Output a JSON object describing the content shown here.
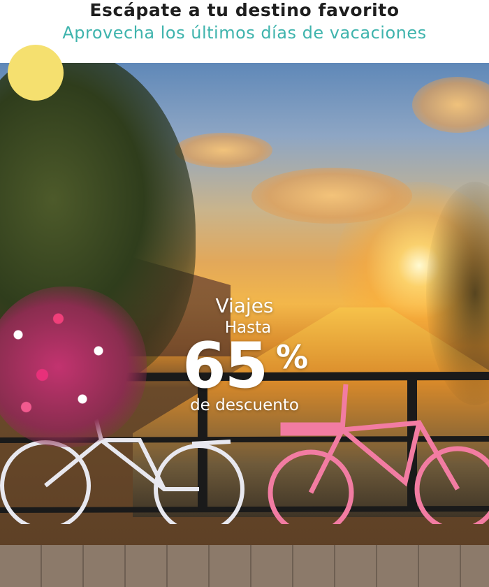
{
  "header": {
    "headline": "Escápate a tu destino favorito",
    "subline": "Aprovecha los últimos días de vacaciones"
  },
  "hero": {
    "image_description_icon": "amsterdam-canal-sunset-photo",
    "promo": {
      "title": "Viajes",
      "prefix": "Hasta",
      "discount_value": "65",
      "discount_unit": "%",
      "suffix": "de descuento"
    }
  },
  "colors": {
    "headline": "#1e1e1e",
    "subline_accent": "#3fb4ad",
    "decor_dot": "#f5e06f",
    "promo_text": "#ffffff"
  }
}
